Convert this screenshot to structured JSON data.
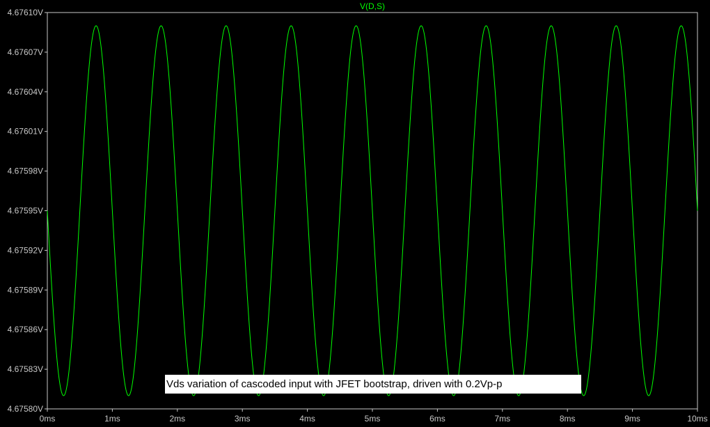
{
  "chart_data": {
    "type": "line",
    "title": "",
    "xlabel": "",
    "ylabel": "",
    "xlim": [
      0,
      10
    ],
    "ylim": [
      4.6758,
      4.6761
    ],
    "x_unit": "ms",
    "y_unit": "V",
    "x_ticks": [
      "0ms",
      "1ms",
      "2ms",
      "3ms",
      "4ms",
      "5ms",
      "6ms",
      "7ms",
      "8ms",
      "9ms",
      "10ms"
    ],
    "y_ticks": [
      "4.67610V",
      "4.67607V",
      "4.67604V",
      "4.67601V",
      "4.67598V",
      "4.67595V",
      "4.67592V",
      "4.67589V",
      "4.67586V",
      "4.67583V",
      "4.67580V"
    ],
    "grid": false,
    "series": [
      {
        "name": "V(D,S)",
        "color": "#00ff00",
        "waveform": "sine",
        "frequency_khz": 1,
        "offset": 4.67595,
        "amplitude": 0.00014,
        "phase_start": "falling",
        "x": [
          0,
          0.25,
          0.75,
          1.25,
          1.75,
          2.25,
          2.75,
          3.25,
          3.75,
          4.25,
          4.75,
          5.25,
          5.75,
          6.25,
          6.75,
          7.25,
          7.75,
          8.25,
          8.75,
          9.25,
          9.75,
          10
        ],
        "y": [
          4.67595,
          4.67581,
          4.67609,
          4.67581,
          4.67609,
          4.67581,
          4.67609,
          4.67581,
          4.67609,
          4.67581,
          4.67609,
          4.67581,
          4.67609,
          4.67581,
          4.67609,
          4.67581,
          4.67609,
          4.67581,
          4.67609,
          4.67581,
          4.67609,
          4.67595
        ]
      }
    ],
    "annotations": [
      {
        "text": "Vds variation of cascoded input with JFET bootstrap, driven with 0.2Vp-p",
        "position": "bottom-center"
      }
    ]
  },
  "colors": {
    "background": "#000000",
    "frame": "#c8c8c8",
    "tick_text": "#c8c8c8",
    "trace": "#00ff00",
    "annotation_bg": "#ffffff",
    "annotation_text": "#000000"
  }
}
